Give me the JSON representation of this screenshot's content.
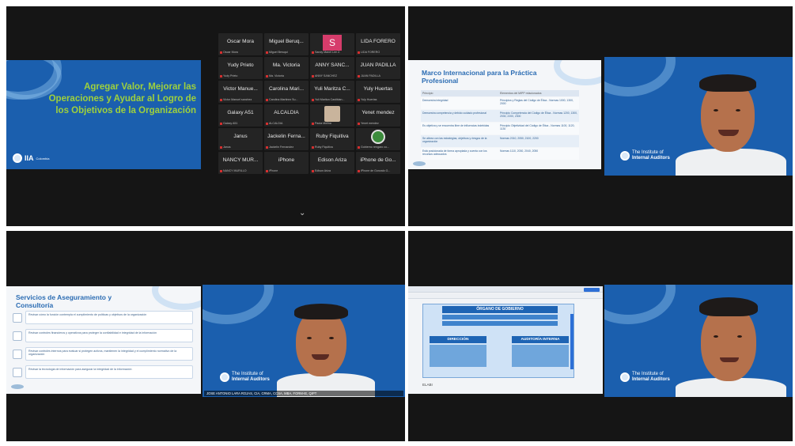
{
  "quadrant_top_left": {
    "slide_title": "Agregar Valor, Mejorar las Operaciones y Ayudar al Logro de los Objetivos de la Organización",
    "brand": "IIA",
    "brand_sub": "Colombia",
    "participants": [
      {
        "name": "Oscar Mora",
        "sub": "Oscar Mora",
        "kind": "name"
      },
      {
        "name": "Miguel Beruq...",
        "sub": "Miguel Beruqui",
        "kind": "name"
      },
      {
        "name": "S",
        "sub": "Sandy Manel Lee Z.",
        "kind": "avatar-s"
      },
      {
        "name": "LIDA FORERO",
        "sub": "LIDA FORERO",
        "kind": "name"
      },
      {
        "name": "Yudy Prieto",
        "sub": "Yudy Prieto",
        "kind": "name"
      },
      {
        "name": "Ma. Victoria",
        "sub": "Ma. Victoria",
        "kind": "name"
      },
      {
        "name": "ANNY SANC...",
        "sub": "ANNY SANCHEZ",
        "kind": "name"
      },
      {
        "name": "JUAN PADILLA",
        "sub": "JUAN PADILLA",
        "kind": "name"
      },
      {
        "name": "Victor Manue...",
        "sub": "Victor Manuel sanchez",
        "kind": "name"
      },
      {
        "name": "Carolina Mari...",
        "sub": "Carolina Martinez Su...",
        "kind": "name"
      },
      {
        "name": "Yuli Maritza C...",
        "sub": "Yuli Maritza Castiblan...",
        "kind": "name"
      },
      {
        "name": "Yuly Huertas",
        "sub": "Yuly Huertas",
        "kind": "name"
      },
      {
        "name": "Galaxy A51",
        "sub": "Galaxy A51",
        "kind": "name"
      },
      {
        "name": "ALCALDIA",
        "sub": "ALCALDIA",
        "kind": "name"
      },
      {
        "name": "",
        "sub": "Paola Molina",
        "kind": "photo"
      },
      {
        "name": "Yenet mendez",
        "sub": "Yenet mendez",
        "kind": "name"
      },
      {
        "name": "Janus",
        "sub": "Janus",
        "kind": "name"
      },
      {
        "name": "Jackelin Ferna...",
        "sub": "Jackelin Fernandez",
        "kind": "name"
      },
      {
        "name": "Ruby Fiquitiva",
        "sub": "Ruby Fiquitiva",
        "kind": "name"
      },
      {
        "name": "",
        "sub": "Gobierno rengaro co...",
        "kind": "logo"
      },
      {
        "name": "NANCY MUR...",
        "sub": "NANCY MURILLO",
        "kind": "name"
      },
      {
        "name": "iPhone",
        "sub": "iPhone",
        "kind": "name"
      },
      {
        "name": "Edison Ariza",
        "sub": "Edison Ariza",
        "kind": "name"
      },
      {
        "name": "iPhone de Go...",
        "sub": "iPhone de Gonzalo G...",
        "kind": "name"
      }
    ],
    "nav_up": "⌃",
    "nav_down": "⌄"
  },
  "quadrant_top_right": {
    "slide_title": "Marco Internacional para la Práctica Profesional",
    "col_a": "Principio",
    "col_b": "Elementos del MIPP relacionados",
    "rows": [
      {
        "a": "Demuestra integridad",
        "b": "Principios y Reglas del Código de Ética - Normas 1000, 1300, 2000"
      },
      {
        "a": "Demuestra competencia y debido cuidado profesional",
        "b": "Principio Competencia del Código de Ética - Normas 1200, 1300, 2030, 2200, 2300"
      },
      {
        "a": "Es objetiva y se encuentra libre de influencias indebidas",
        "b": "Principio Objetividad del Código de Ética - Normas 1100, 1120, 1130"
      },
      {
        "a": "Se alinea con las estrategias, objetivos y riesgos de la organización",
        "b": "Normas 2010, 2050, 2100, 2200"
      },
      {
        "a": "Está posicionada de forma apropiada y cuenta con los recursos adecuados",
        "b": "Normas 1110, 2030, 2040, 2050"
      }
    ],
    "speaker_brand_line1": "The Institute of",
    "speaker_brand_line2": "Internal Auditors"
  },
  "quadrant_bottom_left": {
    "slide_title": "Servicios de Aseguramiento y Consultoría",
    "items": [
      "Revisar cómo la función contempla el cumplimiento de políticas y objetivos de la organización",
      "Revisar controles financieros y operativos para proteger la confiabilidad e integridad de la información",
      "Revisar controles internos para evaluar si protegen activos, mantienen la integridad y el cumplimiento normativo de la organización",
      "Revisar la tecnología de información para asegurar la integridad de la información"
    ],
    "speaker_brand_line1": "The Institute of",
    "speaker_brand_line2": "Internal Auditors",
    "speaker_caption": "JOSE ANTONIO LARA ROJAS, CIA, CRMA, CCSA, MBA, FORM-IE, QIPT"
  },
  "quadrant_bottom_right": {
    "doc_header": "ÓRGANO DE GOBIERNO",
    "box_direction": "DIRECCIÓN",
    "box_audit": "AUDITORÍA INTERNA",
    "footer_left": "ELABI",
    "speaker_brand_line1": "The Institute of",
    "speaker_brand_line2": "Internal Auditors"
  }
}
